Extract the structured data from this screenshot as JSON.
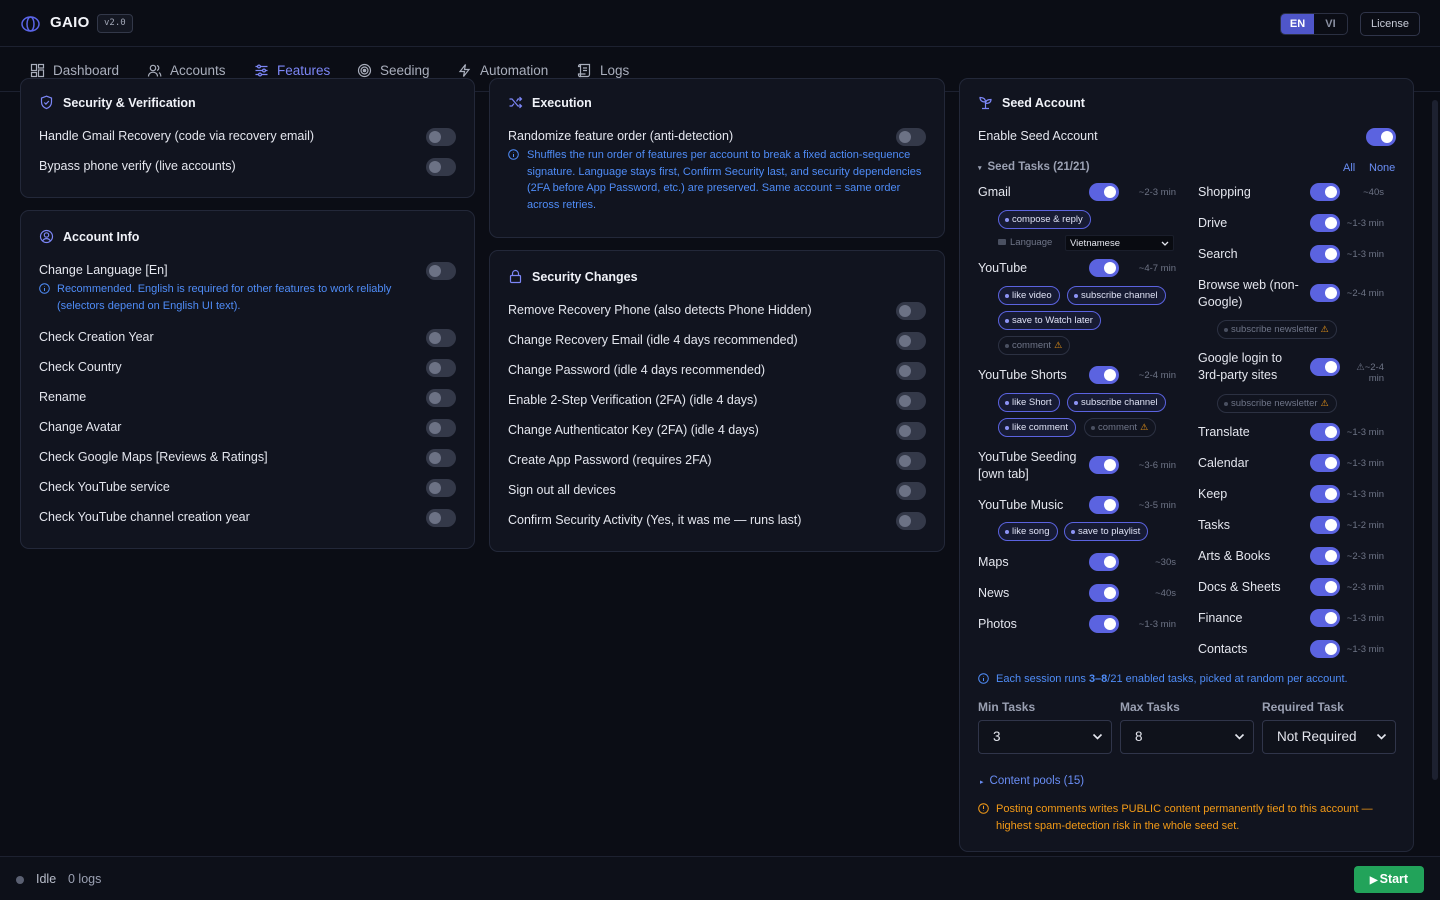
{
  "app": {
    "name": "GAIO",
    "version": "v2.0",
    "lang_en": "EN",
    "lang_vi": "VI",
    "license": "License"
  },
  "nav": {
    "dashboard": "Dashboard",
    "accounts": "Accounts",
    "features": "Features",
    "seeding": "Seeding",
    "automation": "Automation",
    "logs": "Logs"
  },
  "security_verification": {
    "title": "Security & Verification",
    "items": [
      {
        "label": "Handle Gmail Recovery (code via recovery email)",
        "enabled": false
      },
      {
        "label": "Bypass phone verify (live accounts)",
        "enabled": false
      }
    ]
  },
  "account_info": {
    "title": "Account Info",
    "change_language": "Change Language [En]",
    "note": "Recommended. English is required for other features to work reliably (selectors depend on English UI text).",
    "items": [
      {
        "label": "Check Creation Year",
        "enabled": false
      },
      {
        "label": "Check Country",
        "enabled": false
      },
      {
        "label": "Rename",
        "enabled": false
      },
      {
        "label": "Change Avatar",
        "enabled": false
      },
      {
        "label": "Check Google Maps [Reviews & Ratings]",
        "enabled": false
      },
      {
        "label": "Check YouTube service",
        "enabled": false
      },
      {
        "label": "Check YouTube channel creation year",
        "enabled": false
      }
    ]
  },
  "execution": {
    "title": "Execution",
    "randomize": "Randomize feature order (anti-detection)",
    "note": "Shuffles the run order of features per account to break a fixed action-sequence signature. Language stays first, Confirm Security last, and security dependencies (2FA before App Password, etc.) are preserved. Same account = same order across retries."
  },
  "security_changes": {
    "title": "Security Changes",
    "items": [
      {
        "label": "Remove Recovery Phone (also detects Phone Hidden)",
        "enabled": false
      },
      {
        "label": "Change Recovery Email (idle 4 days recommended)",
        "enabled": false
      },
      {
        "label": "Change Password (idle 4 days recommended)",
        "enabled": false
      },
      {
        "label": "Enable 2-Step Verification (2FA) (idle 4 days)",
        "enabled": false
      },
      {
        "label": "Change Authenticator Key (2FA) (idle 4 days)",
        "enabled": false
      },
      {
        "label": "Create App Password (requires 2FA)",
        "enabled": false
      },
      {
        "label": "Sign out all devices",
        "enabled": false
      },
      {
        "label": "Confirm Security Activity (Yes, it was me — runs last)",
        "enabled": false
      }
    ]
  },
  "seed": {
    "title": "Seed Account",
    "enable": "Enable Seed Account",
    "tasks_header": "Seed Tasks (21/21)",
    "all": "All",
    "none": "None",
    "language_label": "Language",
    "language_value": "Vietnamese",
    "left": [
      {
        "name": "Gmail",
        "est": "~2-3 min"
      },
      {
        "name": "YouTube",
        "est": "~4-7 min"
      },
      {
        "name": "YouTube Shorts",
        "est": "~2-4 min"
      },
      {
        "name": "YouTube Seeding [own tab]",
        "est": "~3-6 min"
      },
      {
        "name": "YouTube Music",
        "est": "~3-5 min"
      },
      {
        "name": "Maps",
        "est": "~30s"
      },
      {
        "name": "News",
        "est": "~40s"
      },
      {
        "name": "Photos",
        "est": "~1-3 min"
      }
    ],
    "chips": {
      "gmail": [
        "compose & reply"
      ],
      "youtube": [
        "like video",
        "subscribe channel",
        "save to Watch later",
        "comment"
      ],
      "shorts": [
        "like Short",
        "subscribe channel",
        "like comment",
        "comment"
      ],
      "music": [
        "like song",
        "save to playlist"
      ],
      "browse": [
        "subscribe newsletter"
      ],
      "login": [
        "subscribe newsletter"
      ]
    },
    "right": [
      {
        "name": "Shopping",
        "est": "~40s"
      },
      {
        "name": "Drive",
        "est": "~1-3 min"
      },
      {
        "name": "Search",
        "est": "~1-3 min"
      },
      {
        "name": "Browse web (non-Google)",
        "est": "~2-4 min"
      },
      {
        "name": "Google login to 3rd-party sites",
        "est": "~2-4 min"
      },
      {
        "name": "Translate",
        "est": "~1-3 min"
      },
      {
        "name": "Calendar",
        "est": "~1-3 min"
      },
      {
        "name": "Keep",
        "est": "~1-3 min"
      },
      {
        "name": "Tasks",
        "est": "~1-2 min"
      },
      {
        "name": "Arts & Books",
        "est": "~2-3 min"
      },
      {
        "name": "Docs & Sheets",
        "est": "~2-3 min"
      },
      {
        "name": "Finance",
        "est": "~1-3 min"
      },
      {
        "name": "Contacts",
        "est": "~1-3 min"
      }
    ],
    "session_a": "Each session runs ",
    "session_b": "3–8",
    "session_c": "/21 enabled tasks, picked at random per account.",
    "min_label": "Min Tasks",
    "min_value": "3",
    "max_label": "Max Tasks",
    "max_value": "8",
    "req_label": "Required Task",
    "req_value": "Not Required",
    "content_pools": "Content pools (15)",
    "warning": "Posting comments writes PUBLIC content permanently tied to this account — highest spam-detection risk in the whole seed set."
  },
  "footer": {
    "status": "Idle",
    "logs": "0 logs",
    "start": "Start"
  }
}
